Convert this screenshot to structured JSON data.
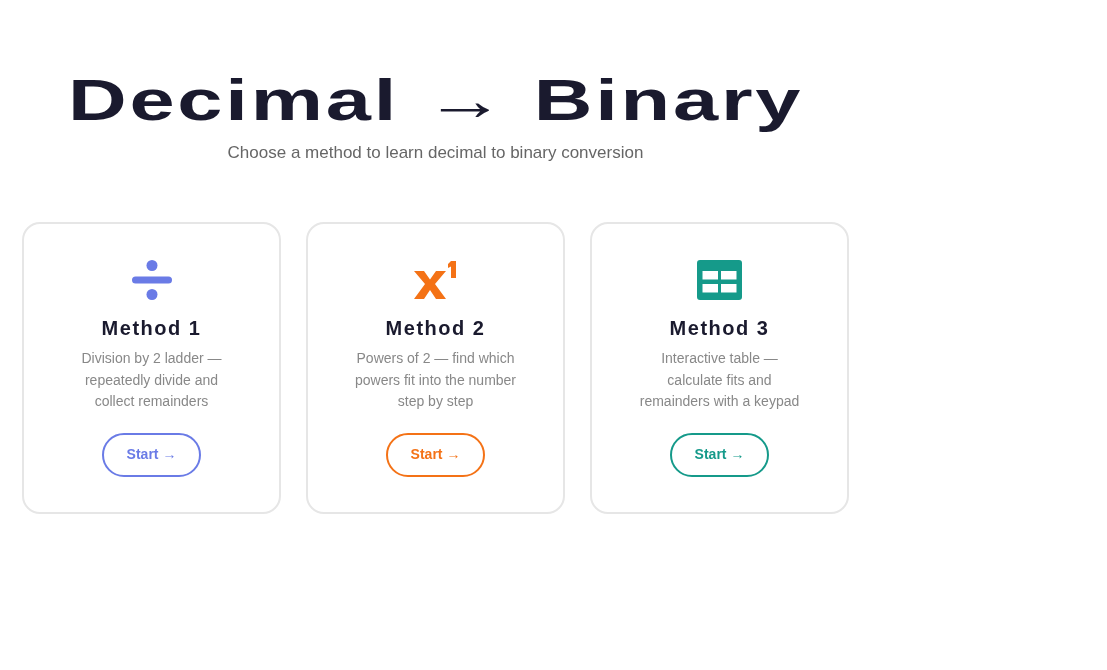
{
  "header": {
    "title": "Decimal → Binary",
    "subtitle": "Choose a method to learn decimal to binary conversion"
  },
  "methods": [
    {
      "kind": "divide",
      "title": "Method 1",
      "description": "Division by 2 ladder — repeatedly divide and collect remainders",
      "button": "Start →",
      "color": "#6a7be6"
    },
    {
      "kind": "powers",
      "title": "Method 2",
      "description": "Powers of 2 — find which powers fit into the number step by step",
      "button": "Start →",
      "color": "#f47216"
    },
    {
      "kind": "table",
      "title": "Method 3",
      "description": "Interactive table — calculate fits and remainders with a keypad",
      "button": "Start →",
      "color": "#159a8a"
    }
  ]
}
